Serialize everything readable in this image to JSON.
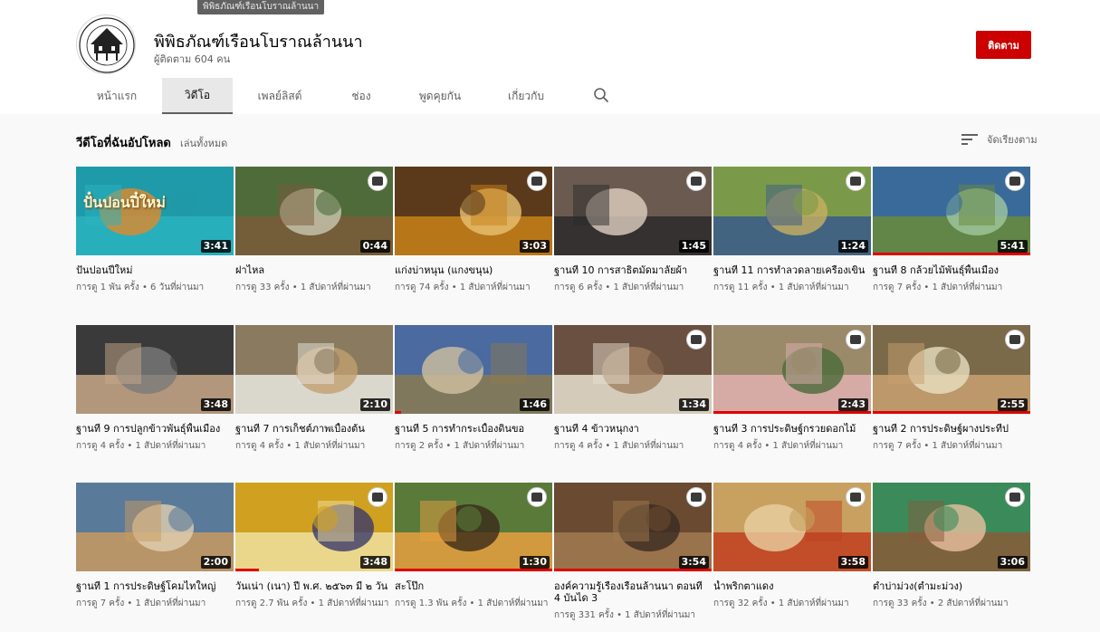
{
  "colors": {
    "accent": "#cc0000",
    "progress": "#e00000",
    "text_secondary": "#606060"
  },
  "tooltip": "พิพิธภัณฑ์เรือนโบราณล้านนา",
  "channel": {
    "name": "พิพิธภัณฑ์เรือนโบราณล้านนา",
    "subscribers": "ผู้ติดตาม 604 คน",
    "subscribe_label": "ติดตาม",
    "logo_text": "Lanna Traditional House Museum"
  },
  "tabs": [
    {
      "label": "หน้าแรก"
    },
    {
      "label": "วิดีโอ",
      "active": true
    },
    {
      "label": "เพลย์ลิสต์"
    },
    {
      "label": "ช่อง"
    },
    {
      "label": "พูดคุยกัน"
    },
    {
      "label": "เกี่ยวกับ"
    }
  ],
  "search_icon": "search-icon",
  "section": {
    "title": "วีดีโอที่ฉันอัปโหลด",
    "play_all": "เล่นทั้งหมด",
    "sort_label": "จัดเรียงตาม",
    "sort_icon": "sort-icon"
  },
  "videos": [
    {
      "title": "ปั่นปอนปี๋ใหม่",
      "meta": "การดู 1 พัน ครั้ง • 6 วันที่ผ่านมา",
      "duration": "3:41",
      "overlay": "ปั๋นปอนปี๋ใหม่",
      "badge": false,
      "progress": 0
    },
    {
      "title": "ฝาไหล",
      "meta": "การดู 33 ครั้ง • 1 สัปดาห์ที่ผ่านมา",
      "duration": "0:44",
      "badge": true,
      "progress": 0
    },
    {
      "title": "แก่งบ่าหนุน (แกงขนุน)",
      "meta": "การดู 74 ครั้ง • 1 สัปดาห์ที่ผ่านมา",
      "duration": "3:03",
      "badge": true,
      "progress": 0
    },
    {
      "title": "ฐานที่ 10 การสาธิตมัดมาลัยผ้า",
      "meta": "การดู 6 ครั้ง • 1 สัปดาห์ที่ผ่านมา",
      "duration": "1:45",
      "badge": true,
      "progress": 0
    },
    {
      "title": "ฐานที่ 11 การทำลวดลายเครื่องเขิน",
      "meta": "การดู 11 ครั้ง • 1 สัปดาห์ที่ผ่านมา",
      "duration": "1:24",
      "badge": true,
      "progress": 0
    },
    {
      "title": "ฐานที่ 8 กล้วยไม้พันธุ์พื้นเมือง",
      "meta": "การดู 7 ครั้ง • 1 สัปดาห์ที่ผ่านมา",
      "duration": "5:41",
      "badge": true,
      "progress": 1
    },
    {
      "title": "ฐานที่ 9 การปลูกข้าวพันธุ์พื้นเมือง",
      "meta": "การดู 4 ครั้ง • 1 สัปดาห์ที่ผ่านมา",
      "duration": "3:48",
      "badge": false,
      "progress": 0
    },
    {
      "title": "ฐานที่ 7 การเก็ชต์ภาพเบื้องต้น",
      "meta": "การดู 4 ครั้ง • 1 สัปดาห์ที่ผ่านมา",
      "duration": "2:10",
      "badge": false,
      "progress": 0
    },
    {
      "title": "ฐานที่ 5 การทำกระเบื้องดินขอ",
      "meta": "การดู 2 ครั้ง • 1 สัปดาห์ที่ผ่านมา",
      "duration": "1:46",
      "badge": false,
      "progress": 0.04
    },
    {
      "title": "ฐานที่ 4 ข้าวหนุกงา",
      "meta": "การดู 4 ครั้ง • 1 สัปดาห์ที่ผ่านมา",
      "duration": "1:34",
      "badge": true,
      "progress": 0
    },
    {
      "title": "ฐานที่ 3 การประดิษฐ์กรวยดอกไม้",
      "meta": "การดู 4 ครั้ง • 1 สัปดาห์ที่ผ่านมา",
      "duration": "2:43",
      "badge": true,
      "progress": 1
    },
    {
      "title": "ฐานที่ 2 การประดิษฐ์ผางประทีป",
      "meta": "การดู 7 ครั้ง • 1 สัปดาห์ที่ผ่านมา",
      "duration": "2:55",
      "badge": true,
      "progress": 1
    },
    {
      "title": "ฐานที่ 1 การประดิษฐ์โคมไทใหญ่",
      "meta": "การดู 7 ครั้ง • 1 สัปดาห์ที่ผ่านมา",
      "duration": "2:00",
      "badge": false,
      "progress": 0
    },
    {
      "title": "วันเน่า (เนา) ปี พ.ศ. ๒๕๖๓ มี ๒ วัน",
      "meta": "การดู 2.7 พัน ครั้ง • 1 สัปดาห์ที่ผ่านมา",
      "duration": "3:48",
      "badge": true,
      "progress": 0.15
    },
    {
      "title": "สะโป๊ก",
      "meta": "การดู 1.3 พัน ครั้ง • 1 สัปดาห์ที่ผ่านมา",
      "duration": "1:30",
      "badge": true,
      "progress": 1
    },
    {
      "title": "องค์ความรู้เรื่องเรือนล้านนา ตอนที่ 4 บันได 3",
      "meta": "การดู 331 ครั้ง • 1 สัปดาห์ที่ผ่านมา",
      "duration": "3:54",
      "badge": true,
      "progress": 1
    },
    {
      "title": "น้ำพริกตาแดง",
      "meta": "การดู 32 ครั้ง • 1 สัปดาห์ที่ผ่านมา",
      "duration": "3:58",
      "badge": true,
      "progress": 0
    },
    {
      "title": "ตำบ่าม่วง(ตำมะม่วง)",
      "meta": "การดู 33 ครั้ง • 2 สัปดาห์ที่ผ่านมา",
      "duration": "3:06",
      "badge": true,
      "progress": 0
    }
  ]
}
